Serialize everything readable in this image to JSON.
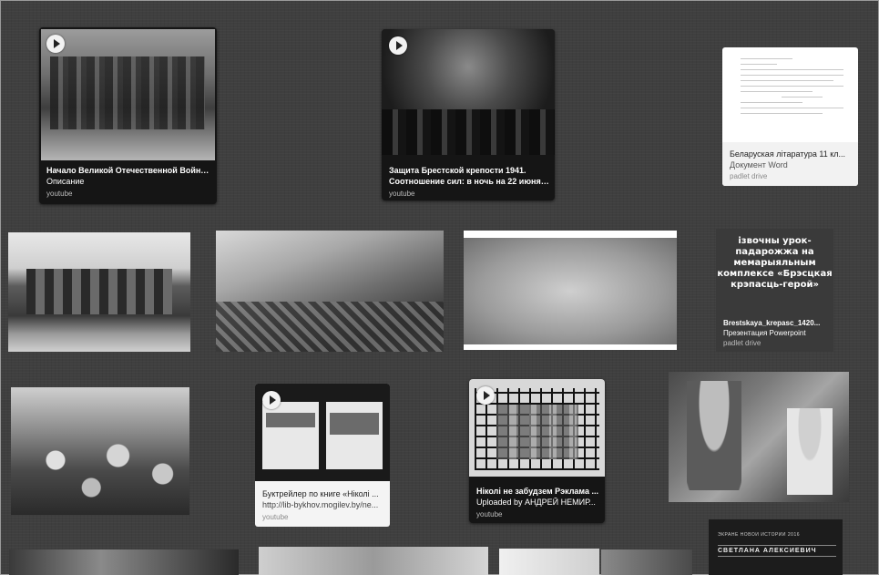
{
  "cards": {
    "video1": {
      "title": "Начало Великой Отечественной Войны-...",
      "subtitle": "Описание",
      "source": "youtube",
      "icon": "play-icon"
    },
    "video2": {
      "title": "Защита Брестской крепости 1941.",
      "subtitle": "Соотношение сил: в ночь на 22 июня в...",
      "source": "youtube",
      "icon": "play-icon"
    },
    "doc": {
      "title": "Беларуская літаратура 11 кл...",
      "subtitle": "Документ Word",
      "source": "padlet drive"
    },
    "pres": {
      "slide_text": "ізвочны урок-падарожжа на мемарыяльным комплексе «Брэсцкая крэпасць-герой»",
      "title": "Brestskaya_krepasc_1420...",
      "subtitle": "Презентация Powerpoint",
      "source": "padlet drive"
    },
    "video3": {
      "title": "Буктрейлер по книге «Ніколі ...",
      "subtitle": "http://lib-bykhov.mogilev.by/ne...",
      "source": "youtube",
      "icon": "play-icon"
    },
    "video4": {
      "title": "Ніколі не забудзем Рэклама ...",
      "subtitle": "Uploaded by АНДРЕЙ НЕМИР...",
      "source": "youtube",
      "icon": "play-icon"
    },
    "poster": {
      "line1": "ЭКРАНЕ НОВОЙ ИСТОРИИ 2016",
      "line2": "СВЕТЛАНА АЛЕКСИЕВИЧ"
    }
  },
  "colors": {
    "background": "#3f3f3f",
    "card_dark": "#151515",
    "card_light": "#f4f4f4"
  }
}
